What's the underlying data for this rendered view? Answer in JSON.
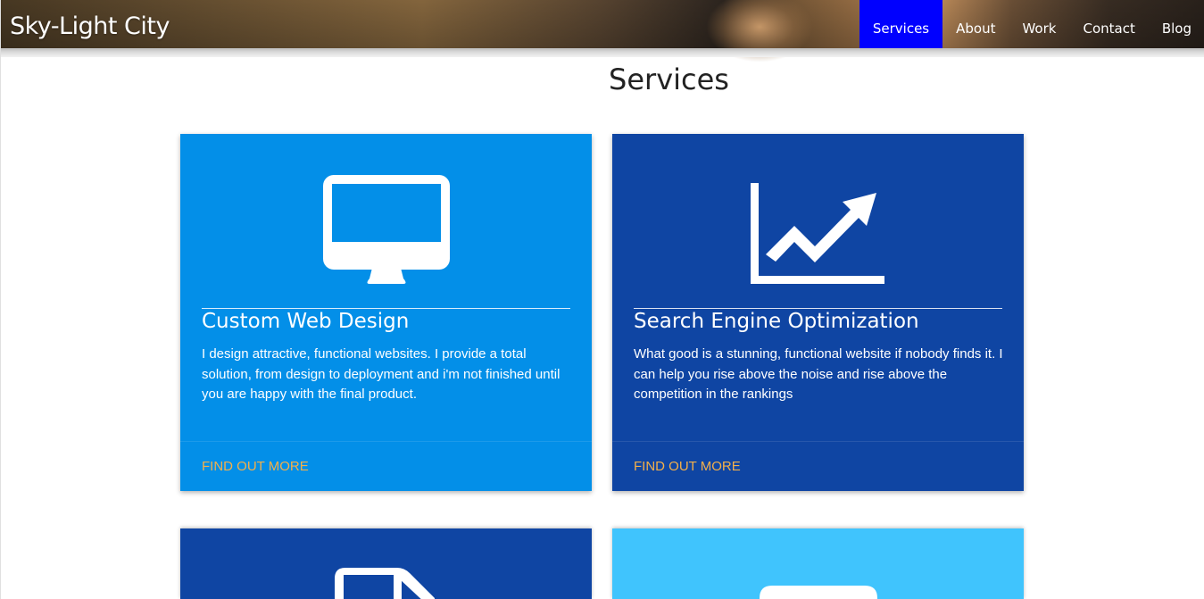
{
  "header": {
    "logo": "Sky-Light City",
    "nav": [
      {
        "label": "Services",
        "active": true
      },
      {
        "label": "About",
        "active": false
      },
      {
        "label": "Work",
        "active": false
      },
      {
        "label": "Contact",
        "active": false
      },
      {
        "label": "Blog",
        "active": false
      }
    ],
    "active_color": "#0000ff"
  },
  "main": {
    "title": "Services",
    "cards": [
      {
        "icon": "desktop-monitor-icon",
        "color": "#038fe8",
        "title": "Custom Web Design",
        "text": "I design attractive, functional websites. I provide a total solution, from design to deployment and i'm not finished until you are happy with the final product.",
        "link": "FIND OUT MORE"
      },
      {
        "icon": "line-chart-trending-up-icon",
        "color": "#0f45a3",
        "title": "Search Engine Optimization",
        "text": "What good is a stunning, functional website if nobody finds it. I can help you rise above the noise and rise above the competition in the rankings",
        "link": "FIND OUT MORE"
      },
      {
        "icon": "truck-icon",
        "color": "#0f45a3"
      },
      {
        "icon": "rounded-box-icon",
        "color": "#40c4fd"
      }
    ],
    "link_color": "#f4b04a"
  }
}
